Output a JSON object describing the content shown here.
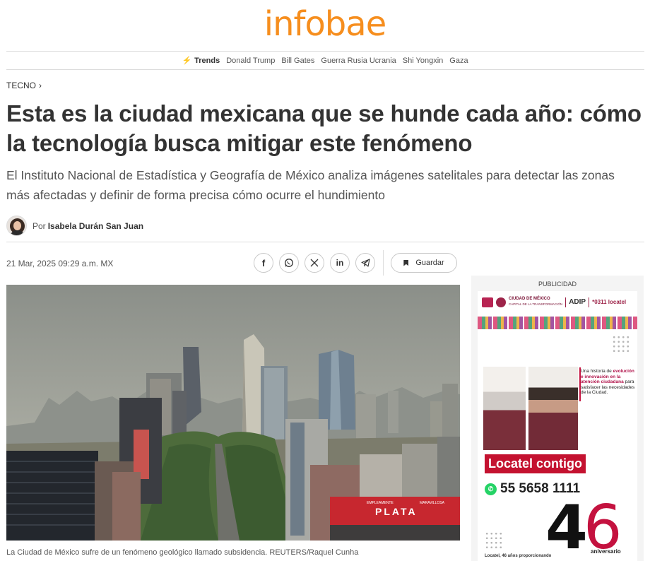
{
  "brand": {
    "logo": "infobae",
    "logo_color": "#f68e1e"
  },
  "trends": {
    "label": "Trends",
    "items": [
      "Donald Trump",
      "Bill Gates",
      "Guerra Rusia Ucrania",
      "Shi Yongxin",
      "Gaza"
    ]
  },
  "article": {
    "section": "TECNO",
    "headline": "Esta es la ciudad mexicana que se hunde cada año: cómo la tecnología busca mitigar este fenómeno",
    "subtitle": "El Instituto Nacional de Estadística y Geografía de México analiza imágenes satelitales para detectar las zonas más afectadas y definir de forma precisa cómo ocurre el hundimiento",
    "author_prefix": "Por",
    "author": "Isabela Durán San Juan",
    "date": "21 Mar, 2025 09:29 a.m. MX",
    "share_icons": [
      "facebook-icon",
      "whatsapp-icon",
      "x-icon",
      "linkedin-icon",
      "telegram-icon"
    ],
    "save_label": "Guardar",
    "image_caption": "La Ciudad de México sufre de un fenómeno geológico llamado subsidencia. REUTERS/Raquel Cunha",
    "image_sign_text": "PLATA",
    "image_sign_left": "EMPLEAMENTE",
    "image_sign_right": "MARAVILLOSA"
  },
  "ad": {
    "label": "PUBLICIDAD",
    "header_city": "CIUDAD DE MÉXICO",
    "header_sub": "CAPITAL DE LA TRANSFORMACIÓN",
    "header_adip": "ADIP",
    "header_locatel": "*0311 locatel",
    "text_1": "Una historia de",
    "text_highlight": "evolución e innovación en la atención ciudadana",
    "text_2": "para satisfacer las necesidades de la Ciudad.",
    "locatel_label": "Locatel contigo",
    "phone": "55 5658 1111",
    "anniversary_number_1": "4",
    "anniversary_number_2": "6",
    "anniversary_label": "aniversario",
    "footer": "Locatel, 46 años proporcionando"
  }
}
